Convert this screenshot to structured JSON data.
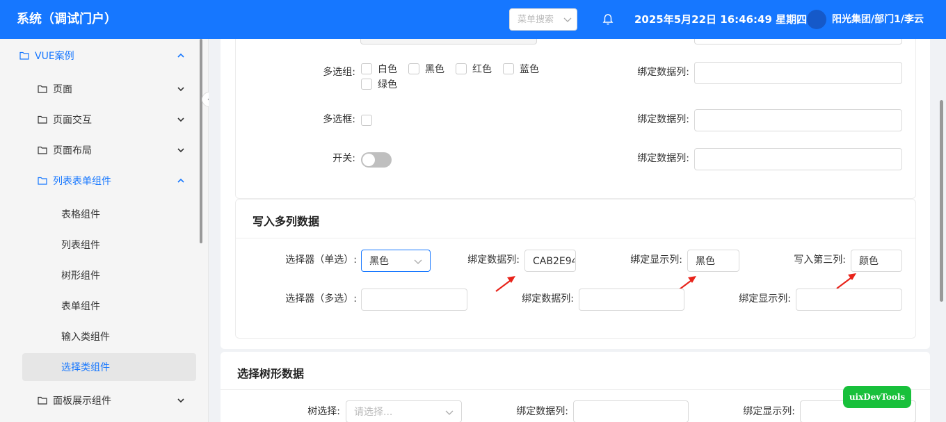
{
  "header": {
    "title": "系统（调试门户）",
    "search_placeholder": "菜单搜索",
    "datetime": "2025年5月22日 16:46:49 星期四",
    "user": "阳光集团/部门1/李云"
  },
  "sidebar": {
    "items": [
      {
        "label": "VUE案例"
      },
      {
        "label": "页面"
      },
      {
        "label": "页面交互"
      },
      {
        "label": "页面布局"
      },
      {
        "label": "列表表单组件"
      },
      {
        "label": "表格组件"
      },
      {
        "label": "列表组件"
      },
      {
        "label": "树形组件"
      },
      {
        "label": "表单组件"
      },
      {
        "label": "输入类组件"
      },
      {
        "label": "选择类组件"
      },
      {
        "label": "面板展示组件"
      }
    ]
  },
  "form1": {
    "multi_group_label": "多选组:",
    "options": [
      "白色",
      "黑色",
      "红色",
      "蓝色",
      "绿色"
    ],
    "checkbox_label": "多选框:",
    "switch_label": "开关:",
    "bind_col_label": "绑定数据列:"
  },
  "section2": {
    "title": "写入多列数据",
    "select_single_label": "选择器（单选）:",
    "select_single_value": "黑色",
    "bind_col_label": "绑定数据列:",
    "bind_col_value": "CAB2E94",
    "bind_display_label": "绑定显示列:",
    "bind_display_value": "黑色",
    "third_col_label": "写入第三列:",
    "third_col_value": "颜色",
    "select_multi_label": "选择器（多选）:",
    "bind_col_label2": "绑定数据列:",
    "bind_display_label2": "绑定显示列:"
  },
  "section3": {
    "title": "选择树形数据",
    "tree_label": "树选择:",
    "tree_placeholder": "请选择...",
    "bind_col_label": "绑定数据列:",
    "bind_display_label": "绑定显示列:"
  },
  "devtools": {
    "label": "uixDevTools"
  },
  "colors": {
    "primary": "#1677ff",
    "arrow": "#e8231a",
    "devtools": "#18c03b"
  }
}
